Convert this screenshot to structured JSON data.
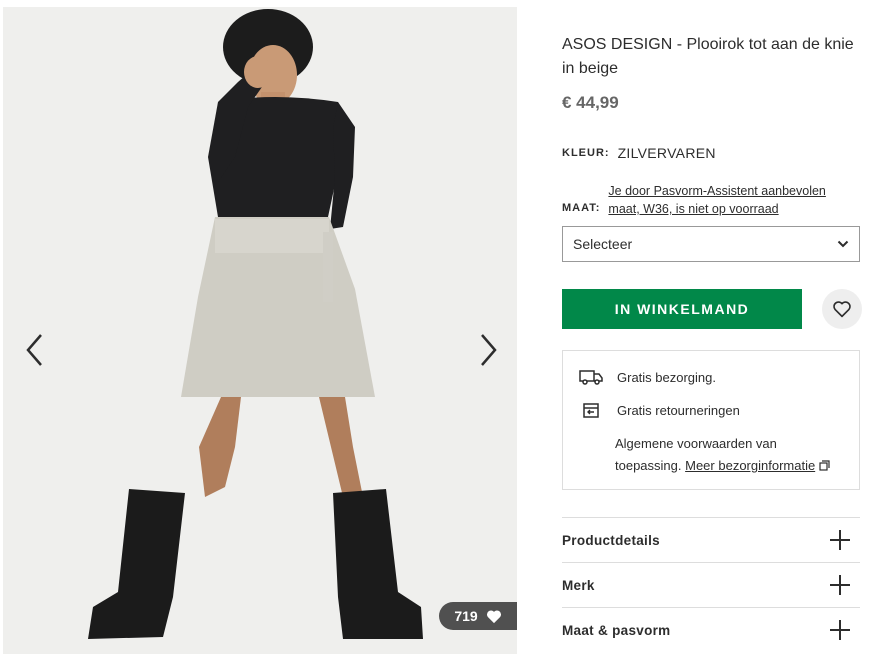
{
  "product": {
    "title": "ASOS DESIGN - Plooirok tot aan de knie in beige",
    "price": "€ 44,99",
    "colour_label": "KLEUR:",
    "colour_value": "ZILVERVAREN",
    "size_label": "MAAT:",
    "size_recommendation": "Je door Pasvorm-Assistent aanbevolen maat, W36, is niet op voorraad",
    "size_select": "Selecteer",
    "add_to_bag": "IN WINKELMAND"
  },
  "gallery": {
    "likes_count": "719",
    "image_alt": "Model wearing beige pleated knee-length skirt with black top and black lace-up boots"
  },
  "delivery": {
    "free_delivery": "Gratis bezorging.",
    "free_returns": "Gratis retourneringen",
    "terms_text": "Algemene voorwaarden van toepassing.",
    "terms_link": "Meer bezorginformatie"
  },
  "accordion": [
    {
      "title": "Productdetails"
    },
    {
      "title": "Merk"
    },
    {
      "title": "Maat & pasvorm"
    }
  ],
  "colors": {
    "accent_green": "#018849",
    "text": "#2d2d2d",
    "price": "#666666"
  },
  "icons": [
    "chevron-left-icon",
    "chevron-right-icon",
    "heart-icon",
    "chevron-down-icon",
    "truck-icon",
    "returns-icon",
    "external-link-icon",
    "plus-icon"
  ]
}
